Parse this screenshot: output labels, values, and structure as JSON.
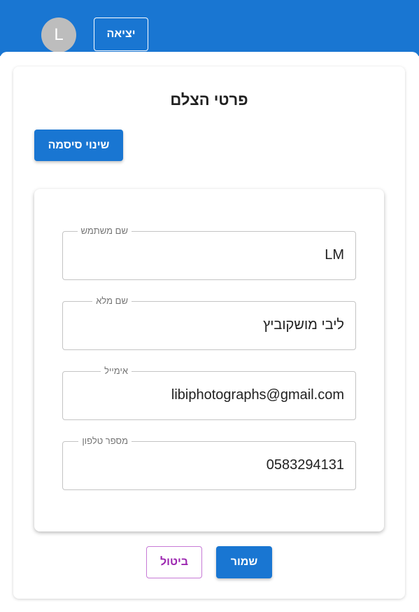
{
  "header": {
    "avatar_letter": "L",
    "logout_label": "יציאה"
  },
  "page": {
    "title": "פרטי הצלם",
    "change_password_label": "שינוי סיסמה"
  },
  "form": {
    "fields": [
      {
        "label": "שם משתמש",
        "value": "LM"
      },
      {
        "label": "שם מלא",
        "value": "ליבי מושקוביץ"
      },
      {
        "label": "אימייל",
        "value": "libiphotographs@gmail.com"
      },
      {
        "label": "מספר טלפון",
        "value": "0583294131"
      }
    ]
  },
  "actions": {
    "save_label": "שמור",
    "cancel_label": "ביטול"
  },
  "colors": {
    "primary": "#1976d2",
    "secondary": "#9c27b0"
  }
}
